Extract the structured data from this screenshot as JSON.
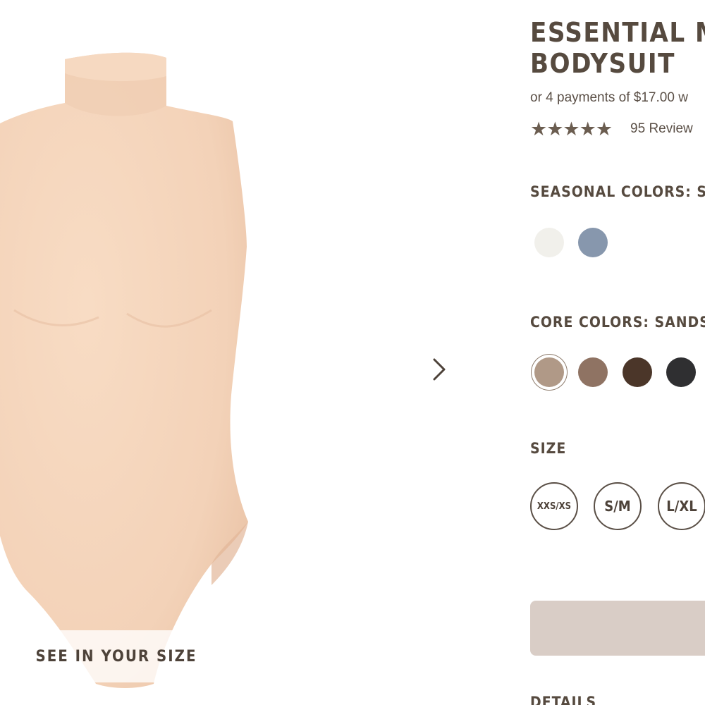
{
  "gallery": {
    "product_image": "bodysuit-product-photo",
    "see_in_your_size": "SEE IN YOUR SIZE",
    "next_icon": "chevron-right-icon"
  },
  "product": {
    "title": "ESSENTIAL MO\nBODYSUIT",
    "payments": "or 4 payments of $17.00 w",
    "rating_stars": "★★★★★",
    "reviews": "95 Review"
  },
  "seasonal": {
    "label": "SEASONAL COLORS: SA",
    "swatches": [
      "#f1f0eb",
      "#8797ad"
    ]
  },
  "core": {
    "label": "CORE COLORS: SANDST",
    "swatches": [
      "#b09987",
      "#8f7363",
      "#4b3629",
      "#2f2f31"
    ]
  },
  "size": {
    "label": "SIZE",
    "options": [
      "XXS/XS",
      "S/M",
      "L/XL"
    ]
  },
  "details": {
    "label": "DETAILS"
  },
  "colors": {
    "add_bar": "#d9cdc6",
    "text": "#564a3f"
  }
}
